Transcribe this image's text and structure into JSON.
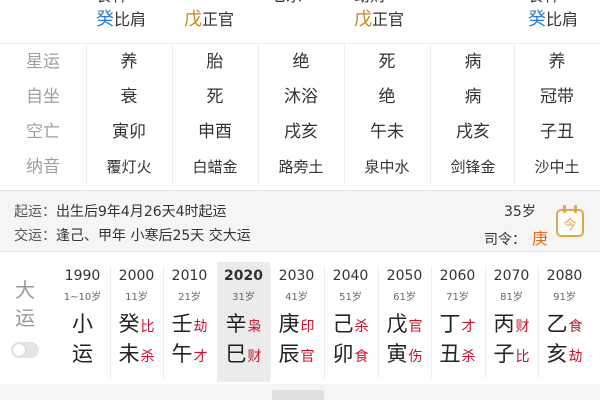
{
  "top_strip": [
    {
      "line0": {
        "stem": "",
        "god": "食神",
        "color": "blue"
      },
      "line1": {
        "stem": "癸",
        "god": "比肩",
        "color": "blue"
      }
    },
    {
      "line0": {
        "stem": "",
        "god": "",
        "color": "orange"
      },
      "line1": {
        "stem": "戊",
        "god": "正官",
        "color": "orange"
      }
    },
    {
      "line0": {
        "stem": "",
        "god": "七杀",
        "color": "blue"
      },
      "line1": {
        "stem": "",
        "god": "",
        "color": "blue"
      }
    },
    {
      "line0": {
        "stem": "",
        "god": "劫财",
        "color": "orange"
      },
      "line1": {
        "stem": "戊",
        "god": "正官",
        "color": "orange"
      }
    },
    {
      "line0": {
        "stem": "",
        "god": "",
        "color": "blue"
      },
      "line1": {
        "stem": "",
        "god": "",
        "color": "blue"
      }
    },
    {
      "line0": {
        "stem": "",
        "god": "食神",
        "color": "blue"
      },
      "line1": {
        "stem": "癸",
        "god": "比肩",
        "color": "blue"
      }
    }
  ],
  "rows": [
    {
      "label": "星运",
      "cells": [
        "养",
        "胎",
        "绝",
        "死",
        "病",
        "养"
      ],
      "small": false
    },
    {
      "label": "自坐",
      "cells": [
        "衰",
        "死",
        "沐浴",
        "绝",
        "病",
        "冠带"
      ],
      "small": false
    },
    {
      "label": "空亡",
      "cells": [
        "寅卯",
        "申酉",
        "戌亥",
        "午未",
        "戌亥",
        "子丑"
      ],
      "small": false
    },
    {
      "label": "纳音",
      "cells": [
        "覆灯火",
        "白蜡金",
        "路旁土",
        "泉中水",
        "剑锋金",
        "沙中土"
      ],
      "small": true
    }
  ],
  "info": {
    "qiyun_label": "起运：",
    "qiyun_text": "出生后9年4月26天4时起运",
    "jiaoyun_label": "交运：",
    "jiaoyun_text": "逢己、甲年 小寒后25天 交大运",
    "age": "35岁",
    "siling_label": "司令：",
    "siling_value": "庚",
    "calendar_icon_text": "今"
  },
  "dayun": {
    "label_top": "大",
    "label_bottom": "运",
    "columns": [
      {
        "year": "1990",
        "age": "1~10岁",
        "a_big": "小",
        "a_red": "",
        "b_big": "运",
        "b_red": "",
        "active": false,
        "center": true
      },
      {
        "year": "2000",
        "age": "11岁",
        "a_big": "癸",
        "a_red": "比",
        "b_big": "未",
        "b_red": "杀",
        "active": false
      },
      {
        "year": "2010",
        "age": "21岁",
        "a_big": "壬",
        "a_red": "劫",
        "b_big": "午",
        "b_red": "才",
        "active": false
      },
      {
        "year": "2020",
        "age": "31岁",
        "a_big": "辛",
        "a_red": "枭",
        "b_big": "巳",
        "b_red": "财",
        "active": true
      },
      {
        "year": "2030",
        "age": "41岁",
        "a_big": "庚",
        "a_red": "印",
        "b_big": "辰",
        "b_red": "官",
        "active": false
      },
      {
        "year": "2040",
        "age": "51岁",
        "a_big": "己",
        "a_red": "杀",
        "b_big": "卯",
        "b_red": "食",
        "active": false
      },
      {
        "year": "2050",
        "age": "61岁",
        "a_big": "戊",
        "a_red": "官",
        "b_big": "寅",
        "b_red": "伤",
        "active": false
      },
      {
        "year": "2060",
        "age": "71岁",
        "a_big": "丁",
        "a_red": "才",
        "b_big": "丑",
        "b_red": "杀",
        "active": false
      },
      {
        "year": "2070",
        "age": "81岁",
        "a_big": "丙",
        "a_red": "财",
        "b_big": "子",
        "b_red": "比",
        "active": false
      },
      {
        "year": "2080",
        "age": "91岁",
        "a_big": "乙",
        "a_red": "食",
        "b_big": "亥",
        "b_red": "劫",
        "active": false
      }
    ]
  }
}
